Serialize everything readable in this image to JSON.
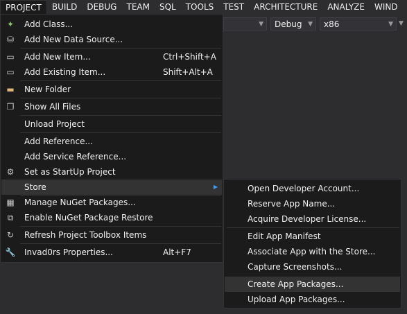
{
  "menubar": {
    "items": [
      "PROJECT",
      "BUILD",
      "DEBUG",
      "TEAM",
      "SQL",
      "TOOLS",
      "TEST",
      "ARCHITECTURE",
      "ANALYZE",
      "WIND"
    ]
  },
  "toolbar": {
    "config_combo": "Debug",
    "platform_combo": "x86"
  },
  "project_menu": {
    "items": [
      {
        "label": "Add Class...",
        "shortcut": "",
        "icon": "add-class-icon"
      },
      {
        "label": "Add New Data Source...",
        "shortcut": "",
        "icon": "add-data-source-icon"
      },
      {
        "label": "Add New Item...",
        "shortcut": "Ctrl+Shift+A",
        "icon": "add-new-item-icon"
      },
      {
        "label": "Add Existing Item...",
        "shortcut": "Shift+Alt+A",
        "icon": "add-existing-item-icon"
      },
      {
        "label": "New Folder",
        "shortcut": "",
        "icon": "new-folder-icon"
      },
      {
        "label": "Show All Files",
        "shortcut": "",
        "icon": "show-all-files-icon"
      },
      {
        "label": "Unload Project",
        "shortcut": "",
        "icon": ""
      },
      {
        "label": "Add Reference...",
        "shortcut": "",
        "icon": ""
      },
      {
        "label": "Add Service Reference...",
        "shortcut": "",
        "icon": ""
      },
      {
        "label": "Set as StartUp Project",
        "shortcut": "",
        "icon": "gear-icon"
      },
      {
        "label": "Store",
        "shortcut": "",
        "icon": ""
      },
      {
        "label": "Manage NuGet Packages...",
        "shortcut": "",
        "icon": "nuget-icon"
      },
      {
        "label": "Enable NuGet Package Restore",
        "shortcut": "",
        "icon": "package-restore-icon"
      },
      {
        "label": "Refresh Project Toolbox Items",
        "shortcut": "",
        "icon": "refresh-icon"
      },
      {
        "label": "Invad0rs Properties...",
        "shortcut": "Alt+F7",
        "icon": "wrench-icon"
      }
    ]
  },
  "store_submenu": {
    "items": [
      {
        "label": "Open Developer Account..."
      },
      {
        "label": "Reserve App Name..."
      },
      {
        "label": "Acquire Developer License..."
      },
      {
        "label": "Edit App Manifest"
      },
      {
        "label": "Associate App with the Store..."
      },
      {
        "label": "Capture Screenshots..."
      },
      {
        "label": "Create App Packages..."
      },
      {
        "label": "Upload App Packages..."
      }
    ]
  }
}
